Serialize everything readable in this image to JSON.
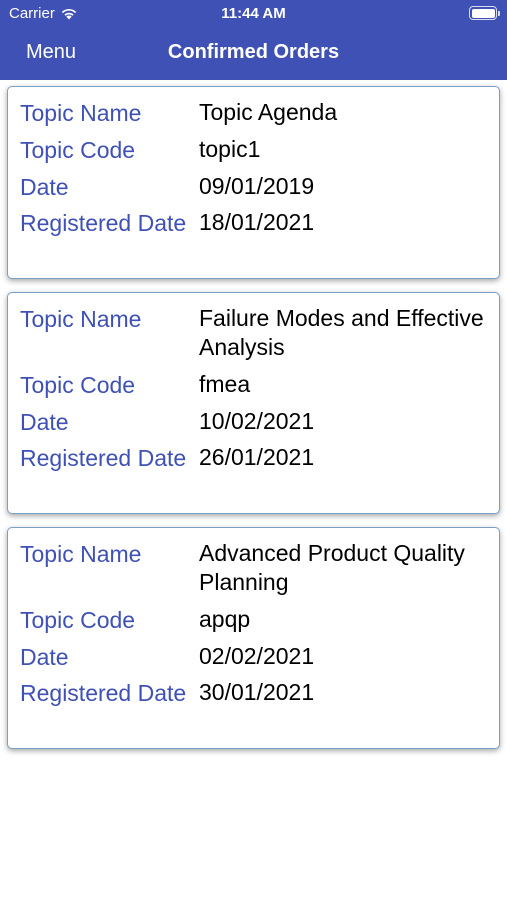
{
  "status_bar": {
    "carrier": "Carrier",
    "time": "11:44 AM"
  },
  "nav": {
    "menu_label": "Menu",
    "title": "Confirmed Orders"
  },
  "colors": {
    "header": "#3f51b5",
    "label": "#3f51b5",
    "card_border": "#7d9fc6"
  },
  "orders": [
    {
      "topic_name_label": "Topic Name",
      "topic_name": "Topic Agenda",
      "topic_code_label": "Topic Code",
      "topic_code": "topic1",
      "date_label": "Date",
      "date": "09/01/2019",
      "registered_date_label": "Registered Date",
      "registered_date": "18/01/2021"
    },
    {
      "topic_name_label": "Topic Name",
      "topic_name": "Failure Modes and Effective Analysis",
      "topic_code_label": "Topic Code",
      "topic_code": "fmea",
      "date_label": "Date",
      "date": "10/02/2021",
      "registered_date_label": "Registered Date",
      "registered_date": "26/01/2021"
    },
    {
      "topic_name_label": "Topic Name",
      "topic_name": "Advanced Product Quality Planning",
      "topic_code_label": "Topic Code",
      "topic_code": "apqp",
      "date_label": "Date",
      "date": "02/02/2021",
      "registered_date_label": "Registered Date",
      "registered_date": "30/01/2021"
    }
  ]
}
